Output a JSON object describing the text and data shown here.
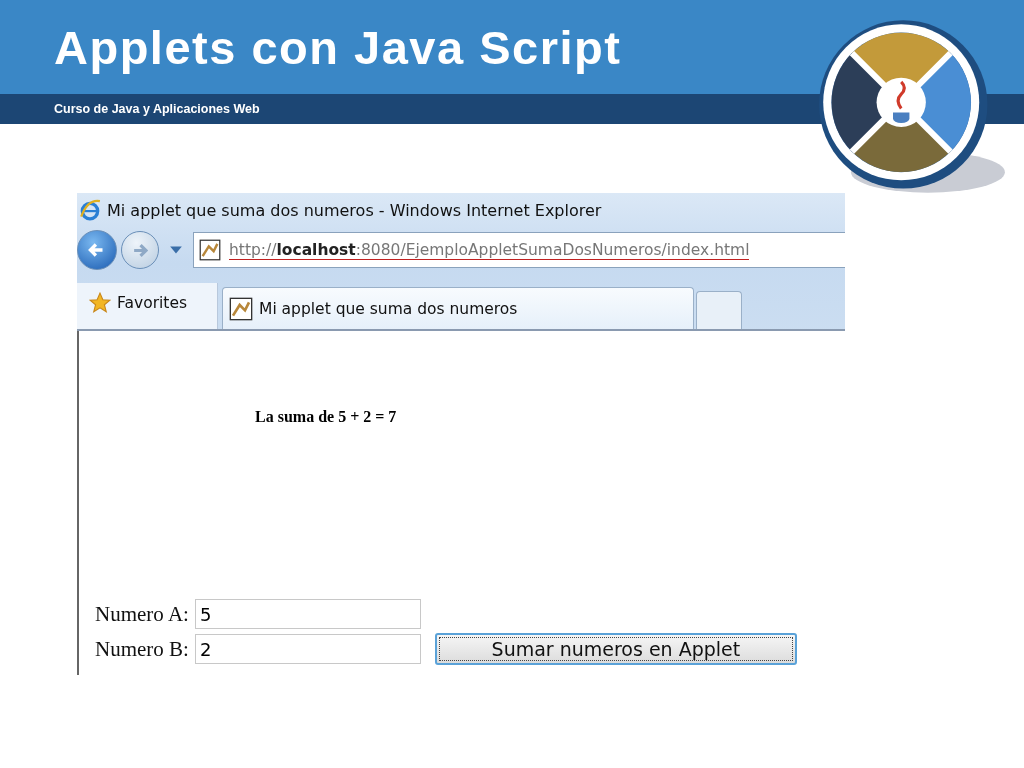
{
  "slide": {
    "title": "Applets con Java Script",
    "subtitle": "Curso de Java y Aplicaciones Web"
  },
  "browser": {
    "window_title": "Mi applet que suma dos numeros - Windows Internet Explorer",
    "address": "http://**localhost**:8080/EjemploAppletSumaDosNumeros/index.html",
    "favorites": "Favorites",
    "tabs": [
      {
        "label": "Mi applet que suma dos numeros",
        "selected": true
      }
    ]
  },
  "page": {
    "applet_text": "La suma de 5 + 2 = 7",
    "fields": [
      {
        "label": "Numero A:",
        "value": "5"
      },
      {
        "label": "Numero B:",
        "value": "2"
      }
    ],
    "button": "Sumar numeros en Applet"
  }
}
